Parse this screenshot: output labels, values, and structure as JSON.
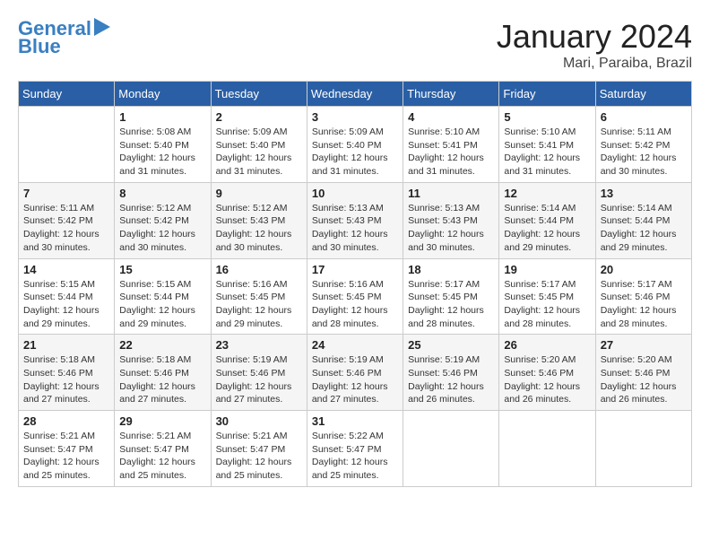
{
  "logo": {
    "line1": "General",
    "line2": "Blue"
  },
  "title": "January 2024",
  "location": "Mari, Paraiba, Brazil",
  "weekdays": [
    "Sunday",
    "Monday",
    "Tuesday",
    "Wednesday",
    "Thursday",
    "Friday",
    "Saturday"
  ],
  "weeks": [
    [
      {
        "day": null,
        "info": null
      },
      {
        "day": "1",
        "info": "Sunrise: 5:08 AM\nSunset: 5:40 PM\nDaylight: 12 hours\nand 31 minutes."
      },
      {
        "day": "2",
        "info": "Sunrise: 5:09 AM\nSunset: 5:40 PM\nDaylight: 12 hours\nand 31 minutes."
      },
      {
        "day": "3",
        "info": "Sunrise: 5:09 AM\nSunset: 5:40 PM\nDaylight: 12 hours\nand 31 minutes."
      },
      {
        "day": "4",
        "info": "Sunrise: 5:10 AM\nSunset: 5:41 PM\nDaylight: 12 hours\nand 31 minutes."
      },
      {
        "day": "5",
        "info": "Sunrise: 5:10 AM\nSunset: 5:41 PM\nDaylight: 12 hours\nand 31 minutes."
      },
      {
        "day": "6",
        "info": "Sunrise: 5:11 AM\nSunset: 5:42 PM\nDaylight: 12 hours\nand 30 minutes."
      }
    ],
    [
      {
        "day": "7",
        "info": "Sunrise: 5:11 AM\nSunset: 5:42 PM\nDaylight: 12 hours\nand 30 minutes."
      },
      {
        "day": "8",
        "info": "Sunrise: 5:12 AM\nSunset: 5:42 PM\nDaylight: 12 hours\nand 30 minutes."
      },
      {
        "day": "9",
        "info": "Sunrise: 5:12 AM\nSunset: 5:43 PM\nDaylight: 12 hours\nand 30 minutes."
      },
      {
        "day": "10",
        "info": "Sunrise: 5:13 AM\nSunset: 5:43 PM\nDaylight: 12 hours\nand 30 minutes."
      },
      {
        "day": "11",
        "info": "Sunrise: 5:13 AM\nSunset: 5:43 PM\nDaylight: 12 hours\nand 30 minutes."
      },
      {
        "day": "12",
        "info": "Sunrise: 5:14 AM\nSunset: 5:44 PM\nDaylight: 12 hours\nand 29 minutes."
      },
      {
        "day": "13",
        "info": "Sunrise: 5:14 AM\nSunset: 5:44 PM\nDaylight: 12 hours\nand 29 minutes."
      }
    ],
    [
      {
        "day": "14",
        "info": "Sunrise: 5:15 AM\nSunset: 5:44 PM\nDaylight: 12 hours\nand 29 minutes."
      },
      {
        "day": "15",
        "info": "Sunrise: 5:15 AM\nSunset: 5:44 PM\nDaylight: 12 hours\nand 29 minutes."
      },
      {
        "day": "16",
        "info": "Sunrise: 5:16 AM\nSunset: 5:45 PM\nDaylight: 12 hours\nand 29 minutes."
      },
      {
        "day": "17",
        "info": "Sunrise: 5:16 AM\nSunset: 5:45 PM\nDaylight: 12 hours\nand 28 minutes."
      },
      {
        "day": "18",
        "info": "Sunrise: 5:17 AM\nSunset: 5:45 PM\nDaylight: 12 hours\nand 28 minutes."
      },
      {
        "day": "19",
        "info": "Sunrise: 5:17 AM\nSunset: 5:45 PM\nDaylight: 12 hours\nand 28 minutes."
      },
      {
        "day": "20",
        "info": "Sunrise: 5:17 AM\nSunset: 5:46 PM\nDaylight: 12 hours\nand 28 minutes."
      }
    ],
    [
      {
        "day": "21",
        "info": "Sunrise: 5:18 AM\nSunset: 5:46 PM\nDaylight: 12 hours\nand 27 minutes."
      },
      {
        "day": "22",
        "info": "Sunrise: 5:18 AM\nSunset: 5:46 PM\nDaylight: 12 hours\nand 27 minutes."
      },
      {
        "day": "23",
        "info": "Sunrise: 5:19 AM\nSunset: 5:46 PM\nDaylight: 12 hours\nand 27 minutes."
      },
      {
        "day": "24",
        "info": "Sunrise: 5:19 AM\nSunset: 5:46 PM\nDaylight: 12 hours\nand 27 minutes."
      },
      {
        "day": "25",
        "info": "Sunrise: 5:19 AM\nSunset: 5:46 PM\nDaylight: 12 hours\nand 26 minutes."
      },
      {
        "day": "26",
        "info": "Sunrise: 5:20 AM\nSunset: 5:46 PM\nDaylight: 12 hours\nand 26 minutes."
      },
      {
        "day": "27",
        "info": "Sunrise: 5:20 AM\nSunset: 5:46 PM\nDaylight: 12 hours\nand 26 minutes."
      }
    ],
    [
      {
        "day": "28",
        "info": "Sunrise: 5:21 AM\nSunset: 5:47 PM\nDaylight: 12 hours\nand 25 minutes."
      },
      {
        "day": "29",
        "info": "Sunrise: 5:21 AM\nSunset: 5:47 PM\nDaylight: 12 hours\nand 25 minutes."
      },
      {
        "day": "30",
        "info": "Sunrise: 5:21 AM\nSunset: 5:47 PM\nDaylight: 12 hours\nand 25 minutes."
      },
      {
        "day": "31",
        "info": "Sunrise: 5:22 AM\nSunset: 5:47 PM\nDaylight: 12 hours\nand 25 minutes."
      },
      {
        "day": null,
        "info": null
      },
      {
        "day": null,
        "info": null
      },
      {
        "day": null,
        "info": null
      }
    ]
  ]
}
